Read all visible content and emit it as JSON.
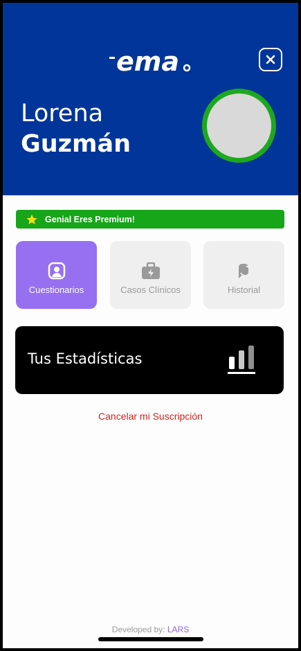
{
  "header": {
    "logo_alt": "ema",
    "first_name": "Lorena",
    "last_name": "Guzmán"
  },
  "premium": {
    "label": "Genial Eres Premium!"
  },
  "tiles": [
    {
      "label": "Cuestionarios",
      "icon": "user-square-icon",
      "active": true
    },
    {
      "label": "Casos Clínicos",
      "icon": "briefcase-bolt-icon",
      "active": false
    },
    {
      "label": "Historial",
      "icon": "history-icon",
      "active": false
    }
  ],
  "stats": {
    "label": "Tus Estadísticas",
    "icon": "bar-chart-icon"
  },
  "cancel": {
    "label": "Cancelar mi Suscripción"
  },
  "footer": {
    "prefix": "Developed by: ",
    "brand": "LARS"
  },
  "colors": {
    "header_bg": "#023599",
    "premium_green": "#17a51a",
    "active_tile": "#9670f0",
    "cancel_red": "#d21f1f",
    "avatar_ring": "#1ea81e"
  }
}
